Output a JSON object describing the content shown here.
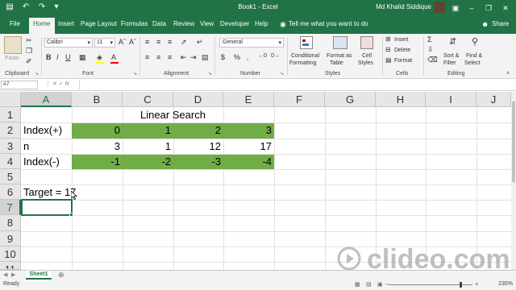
{
  "window": {
    "title": "Book1  -  Excel",
    "user": "Md Khalid Siddique",
    "quick_access": [
      "save-icon",
      "undo-icon",
      "redo-icon",
      "customize-icon"
    ],
    "controls": [
      "ribbon-display-icon",
      "minimize-icon",
      "restore-icon",
      "close-icon"
    ]
  },
  "tabs": [
    "File",
    "Home",
    "Insert",
    "Page Layout",
    "Formulas",
    "Data",
    "Review",
    "View",
    "Developer",
    "Help"
  ],
  "tell_me": "Tell me what you want to do",
  "share": "Share",
  "ribbon": {
    "clipboard": {
      "label": "Clipboard",
      "paste": "Paste"
    },
    "font": {
      "label": "Font",
      "name": "Calibri",
      "size": "11"
    },
    "alignment": {
      "label": "Alignment"
    },
    "number": {
      "label": "Number",
      "format": "General",
      "currency": "$",
      "percent": "%"
    },
    "styles": {
      "label": "Styles",
      "conditional_1": "Conditional",
      "conditional_2": "Formatting",
      "format_as_1": "Format as",
      "format_as_2": "Table",
      "cell_styles_1": "Cell",
      "cell_styles_2": "Styles"
    },
    "cells": {
      "label": "Cells",
      "insert": "Insert",
      "delete": "Delete",
      "format": "Format"
    },
    "editing": {
      "label": "Editing",
      "sum": "Σ",
      "sort_1": "Sort &",
      "sort_2": "Filter",
      "find_1": "Find &",
      "find_2": "Select"
    }
  },
  "formula_bar": {
    "name_box": "A7",
    "fx": "fx",
    "value": ""
  },
  "grid": {
    "columns": [
      "A",
      "B",
      "C",
      "D",
      "E",
      "F",
      "G",
      "H",
      "I",
      "J"
    ],
    "rows": [
      "1",
      "2",
      "3",
      "4",
      "5",
      "6",
      "7",
      "8",
      "9",
      "10",
      "11"
    ],
    "selected_column": "A",
    "selected_row": "7",
    "cells": {
      "C1": "Linear Search",
      "A2": "Index(+)",
      "B2": "0",
      "C2": "1",
      "D2": "2",
      "E2": "3",
      "A3": "n",
      "B3": "3",
      "C3": "1",
      "D3": "12",
      "E3": "17",
      "A4": "Index(-)",
      "B4": "-1",
      "C4": "-2",
      "D4": "-3",
      "E4": "-4",
      "A6": "Target = 17"
    },
    "fill_color": "#70ad47"
  },
  "sheet_tab": "Sheet1",
  "status": {
    "ready": "Ready",
    "zoom": "235%"
  },
  "watermark": "clideo.com",
  "accent": "#217346"
}
